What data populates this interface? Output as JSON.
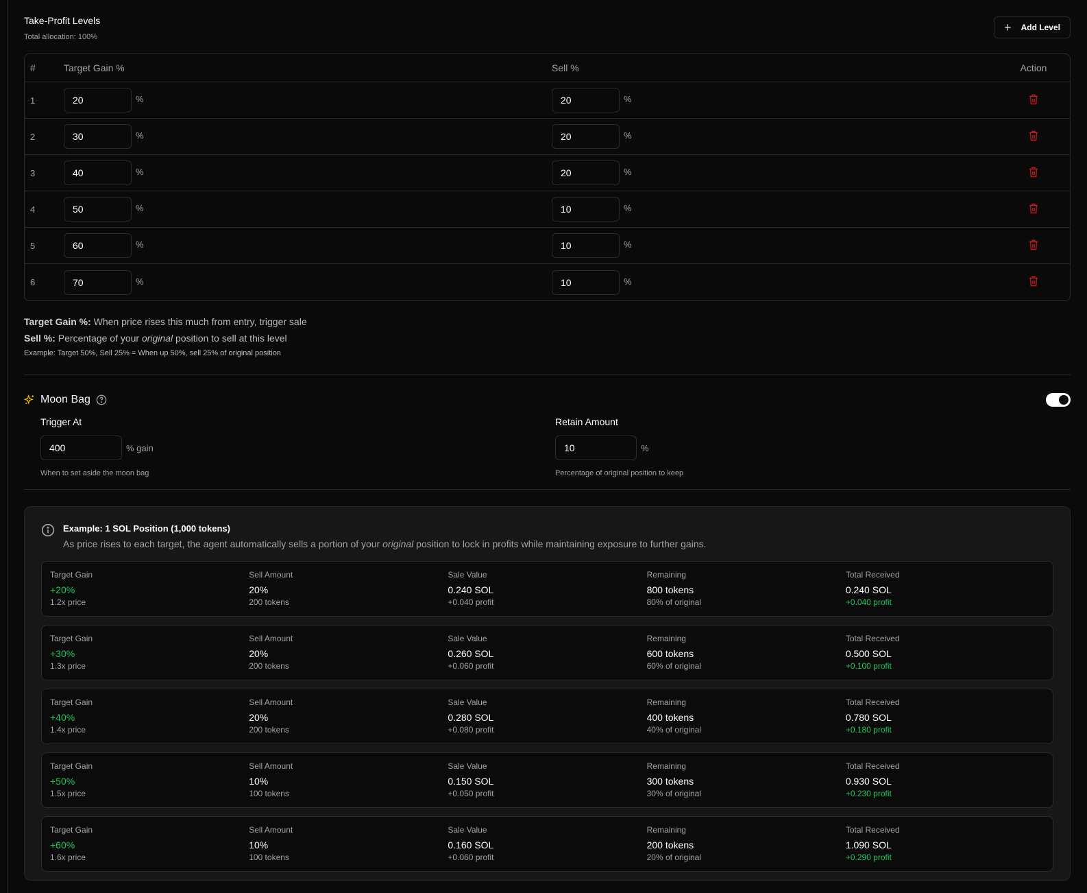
{
  "header": {
    "title": "Take-Profit Levels",
    "allocation": "Total allocation: 100%",
    "add_label": "Add Level"
  },
  "table": {
    "headers": {
      "num": "#",
      "gain": "Target Gain %",
      "sell": "Sell %",
      "action": "Action"
    },
    "unit": "%",
    "rows": [
      {
        "n": "1",
        "gain": "20",
        "sell": "20"
      },
      {
        "n": "2",
        "gain": "30",
        "sell": "20"
      },
      {
        "n": "3",
        "gain": "40",
        "sell": "20"
      },
      {
        "n": "4",
        "gain": "50",
        "sell": "10"
      },
      {
        "n": "5",
        "gain": "60",
        "sell": "10"
      },
      {
        "n": "6",
        "gain": "70",
        "sell": "10"
      }
    ]
  },
  "help": {
    "gain_term": "Target Gain %:",
    "gain_desc": " When price rises this much from entry, trigger sale",
    "sell_term": "Sell %:",
    "sell_pre": " Percentage of your ",
    "sell_em": "original",
    "sell_post": " position to sell at this level",
    "example": "Example: Target 50%, Sell 25% = When up 50%, sell 25% of original position"
  },
  "moon": {
    "title": "Moon Bag",
    "enabled": true,
    "trigger_label": "Trigger At",
    "trigger_value": "400",
    "trigger_unit": "% gain",
    "trigger_hint": "When to set aside the moon bag",
    "retain_label": "Retain Amount",
    "retain_value": "10",
    "retain_unit": "%",
    "retain_hint": "Percentage of original position to keep"
  },
  "example": {
    "title": "Example: 1 SOL Position (1,000 tokens)",
    "desc_pre": "As price rises to each target, the agent automatically sells a portion of your ",
    "desc_em": "original",
    "desc_post": " position to lock in profits while maintaining exposure to further gains.",
    "labels": {
      "gain": "Target Gain",
      "sell": "Sell Amount",
      "value": "Sale Value",
      "remaining": "Remaining",
      "total": "Total Received"
    },
    "rows": [
      {
        "gain": "+20%",
        "price": "1.2x price",
        "sell": "20%",
        "tokens": "200 tokens",
        "value": "0.240 SOL",
        "profit": "+0.040 profit",
        "remaining": "800 tokens",
        "rem_pct": "80% of original",
        "total": "0.240 SOL",
        "total_profit": "+0.040 profit"
      },
      {
        "gain": "+30%",
        "price": "1.3x price",
        "sell": "20%",
        "tokens": "200 tokens",
        "value": "0.260 SOL",
        "profit": "+0.060 profit",
        "remaining": "600 tokens",
        "rem_pct": "60% of original",
        "total": "0.500 SOL",
        "total_profit": "+0.100 profit"
      },
      {
        "gain": "+40%",
        "price": "1.4x price",
        "sell": "20%",
        "tokens": "200 tokens",
        "value": "0.280 SOL",
        "profit": "+0.080 profit",
        "remaining": "400 tokens",
        "rem_pct": "40% of original",
        "total": "0.780 SOL",
        "total_profit": "+0.180 profit"
      },
      {
        "gain": "+50%",
        "price": "1.5x price",
        "sell": "10%",
        "tokens": "100 tokens",
        "value": "0.150 SOL",
        "profit": "+0.050 profit",
        "remaining": "300 tokens",
        "rem_pct": "30% of original",
        "total": "0.930 SOL",
        "total_profit": "+0.230 profit"
      },
      {
        "gain": "+60%",
        "price": "1.6x price",
        "sell": "10%",
        "tokens": "100 tokens",
        "value": "0.160 SOL",
        "profit": "+0.060 profit",
        "remaining": "200 tokens",
        "rem_pct": "20% of original",
        "total": "1.090 SOL",
        "total_profit": "+0.290 profit"
      }
    ]
  },
  "colors": {
    "accent_green": "#22c55e",
    "danger": "#b91c1c",
    "moon_icon": "#eab308"
  }
}
